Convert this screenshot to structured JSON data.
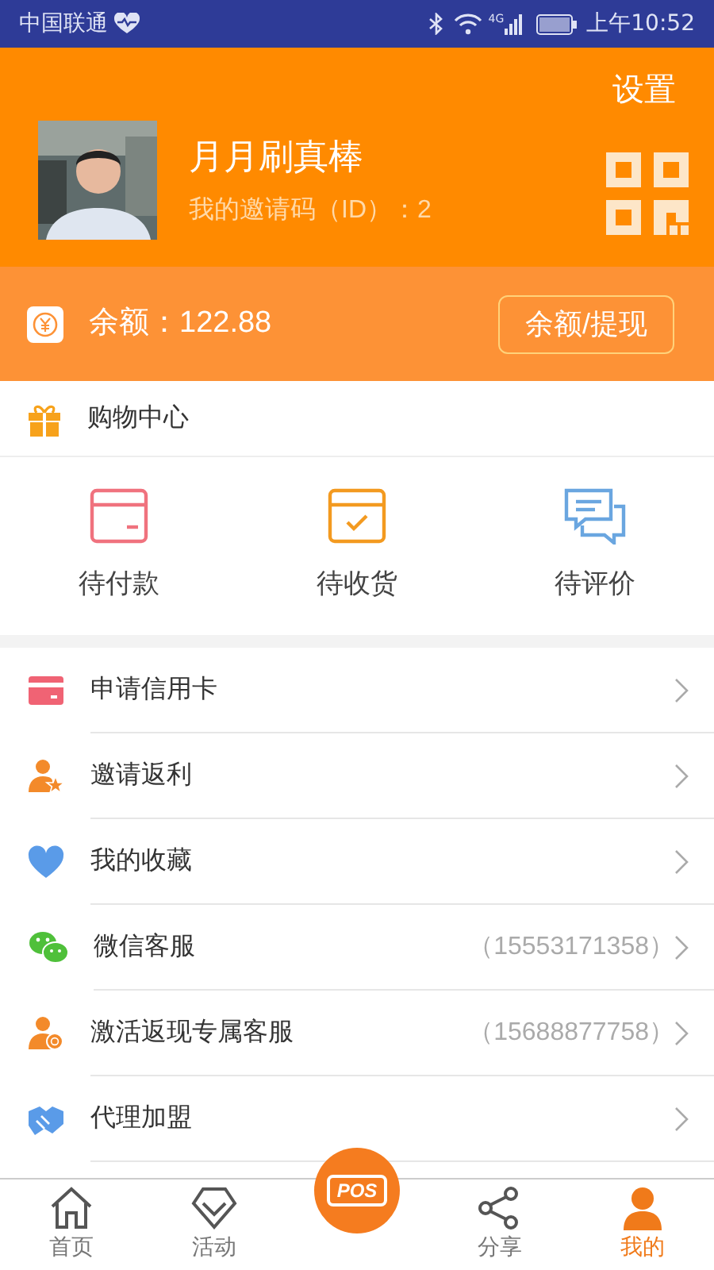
{
  "status_bar": {
    "carrier": "中国联通",
    "network": "4G",
    "time": "上午10:52"
  },
  "profile": {
    "settings": "设置",
    "name": "月月刷真棒",
    "invite_code": "我的邀请码（ID）：2"
  },
  "balance": {
    "label": "余额：122.88",
    "button": "余额/提现"
  },
  "shopping": {
    "title": "购物中心",
    "orders": [
      {
        "kind": "pay",
        "label": "待付款"
      },
      {
        "kind": "receive",
        "label": "待收货"
      },
      {
        "kind": "review",
        "label": "待评价"
      }
    ]
  },
  "menu": [
    {
      "kind": "card",
      "label": "申请信用卡"
    },
    {
      "kind": "invite",
      "label": "邀请返利"
    },
    {
      "kind": "favorite",
      "label": "我的收藏"
    },
    {
      "kind": "wechat",
      "label": "微信客服",
      "detail": "（15553171358）"
    },
    {
      "kind": "service",
      "label": "激活返现专属客服",
      "detail": "（15688877758）"
    },
    {
      "kind": "agent",
      "label": "代理加盟"
    }
  ],
  "tab_bar": [
    {
      "kind": "home",
      "label": "首页",
      "selected": false
    },
    {
      "kind": "activity",
      "label": "活动",
      "selected": false
    },
    {
      "kind": "pos",
      "label": "POS",
      "selected": false
    },
    {
      "kind": "share",
      "label": "分享",
      "selected": false
    },
    {
      "kind": "me",
      "label": "我的",
      "selected": true
    }
  ]
}
